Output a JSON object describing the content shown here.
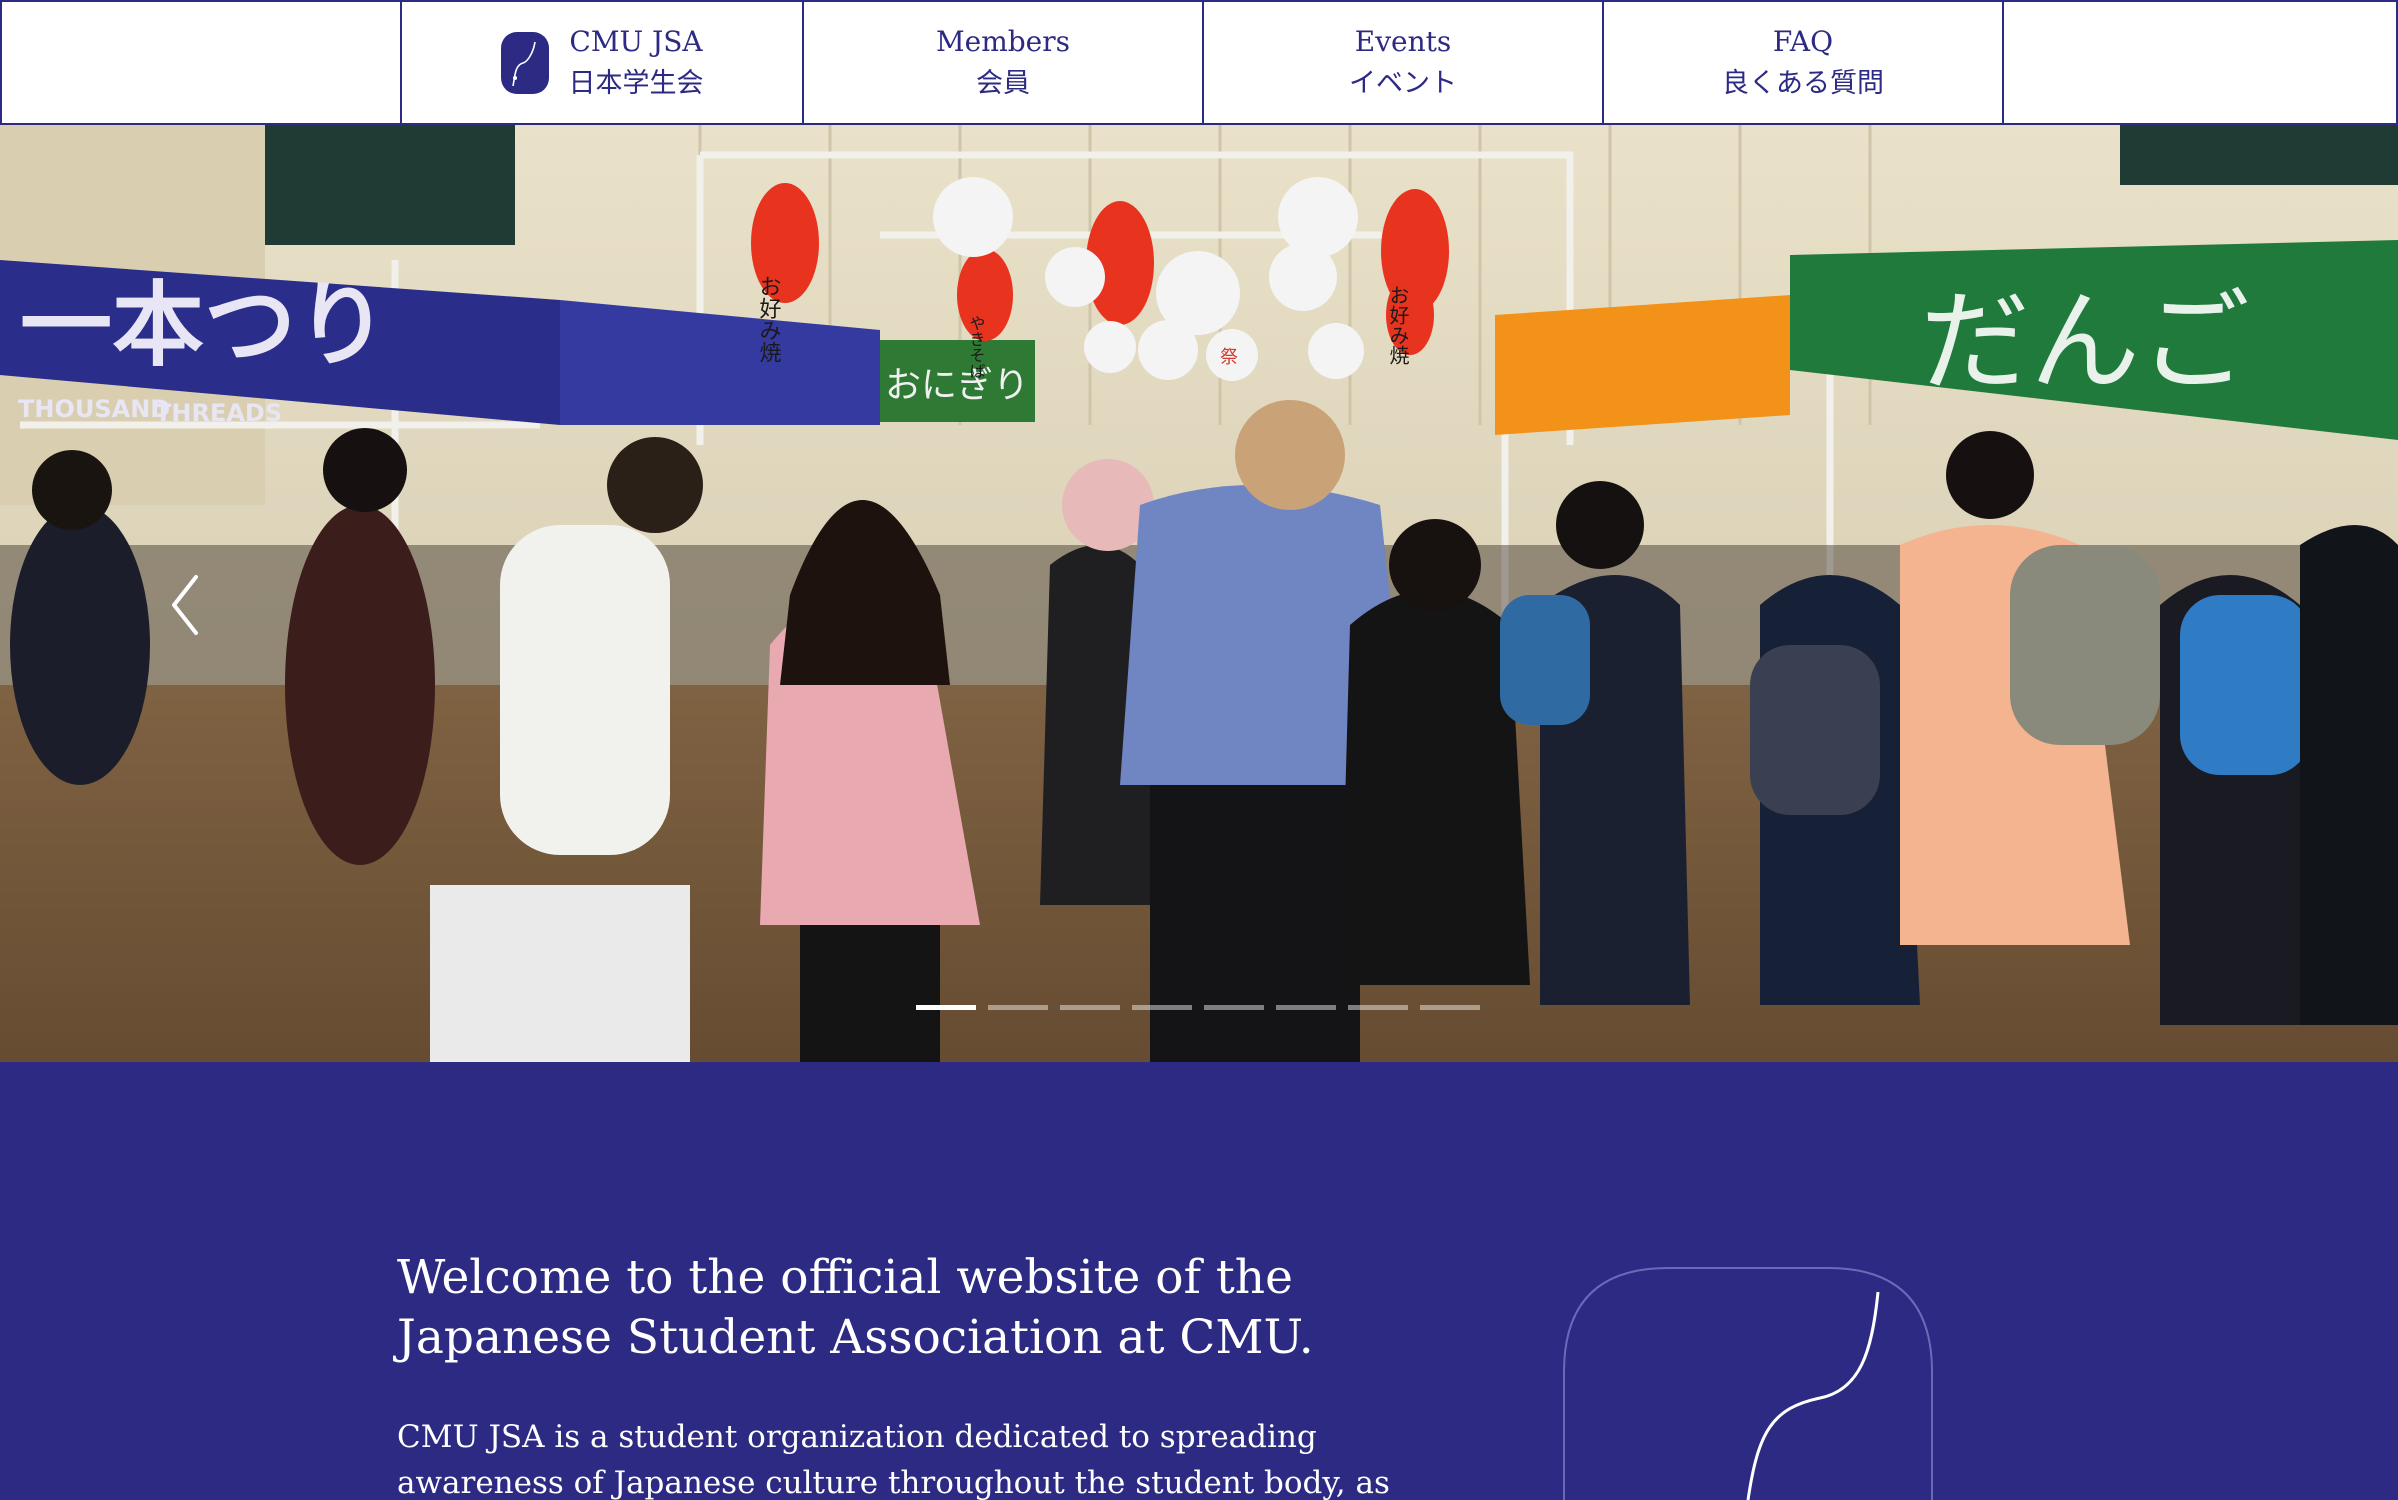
{
  "nav": {
    "brand": {
      "en": "CMU JSA",
      "ja": "日本学生会"
    },
    "items": [
      {
        "en": "Members",
        "ja": "会員"
      },
      {
        "en": "Events",
        "ja": "イベント"
      },
      {
        "en": "FAQ",
        "ja": "良くある質問"
      }
    ]
  },
  "hero": {
    "slide_count": 8,
    "active_slide": 1,
    "banners": {
      "blue": "一本つり",
      "blue_sub_1": "THOUSAND",
      "blue_sub_2": "THREADS",
      "green_small": "おにぎり",
      "green_large": "だんご",
      "lantern_1": "お好み焼",
      "lantern_2": "やきそば",
      "lantern_3": "お好み焼",
      "paper_lantern": "祭"
    }
  },
  "welcome": {
    "heading_line1": "Welcome to the official website of the",
    "heading_line2": "Japanese Student Association at CMU.",
    "body": "CMU JSA is a student organization dedicated to spreading awareness of Japanese culture throughout the student body, as well as the"
  },
  "colors": {
    "brand_indigo": "#2c2a83",
    "nav_background": "#ffffff",
    "welcome_text": "#ffffff"
  },
  "icons": {
    "brand_logo": "jsa-logo-icon",
    "carousel_prev": "chevron-left-icon"
  }
}
